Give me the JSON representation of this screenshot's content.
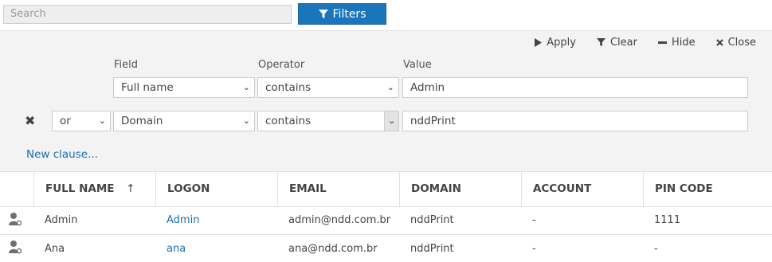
{
  "search": {
    "placeholder": "Search"
  },
  "filters_button": {
    "label": "Filters"
  },
  "toolbar": {
    "apply": "Apply",
    "clear": "Clear",
    "hide": "Hide",
    "close": "Close"
  },
  "filter": {
    "headers": {
      "field": "Field",
      "operator": "Operator",
      "value": "Value"
    },
    "clauses": [
      {
        "field": "Full name",
        "operator": "contains",
        "value": "Admin"
      },
      {
        "connector": "or",
        "field": "Domain",
        "operator": "contains",
        "value": "nddPrint"
      }
    ],
    "new_clause": "New clause..."
  },
  "table": {
    "columns": [
      "FULL NAME",
      "LOGON",
      "EMAIL",
      "DOMAIN",
      "ACCOUNT",
      "PIN CODE"
    ],
    "sort_indicator": "↑",
    "rows": [
      {
        "full_name": "Admin",
        "logon": "Admin",
        "email": "admin@ndd.com.br",
        "domain": "nddPrint",
        "account": "-",
        "pin_code": "1111"
      },
      {
        "full_name": "Ana",
        "logon": "ana",
        "email": "ana@ndd.com.br",
        "domain": "nddPrint",
        "account": "-",
        "pin_code": "-"
      }
    ]
  },
  "colors": {
    "accent": "#1b75bb",
    "link": "#1b6fb5",
    "panel": "#f3f3f3"
  }
}
